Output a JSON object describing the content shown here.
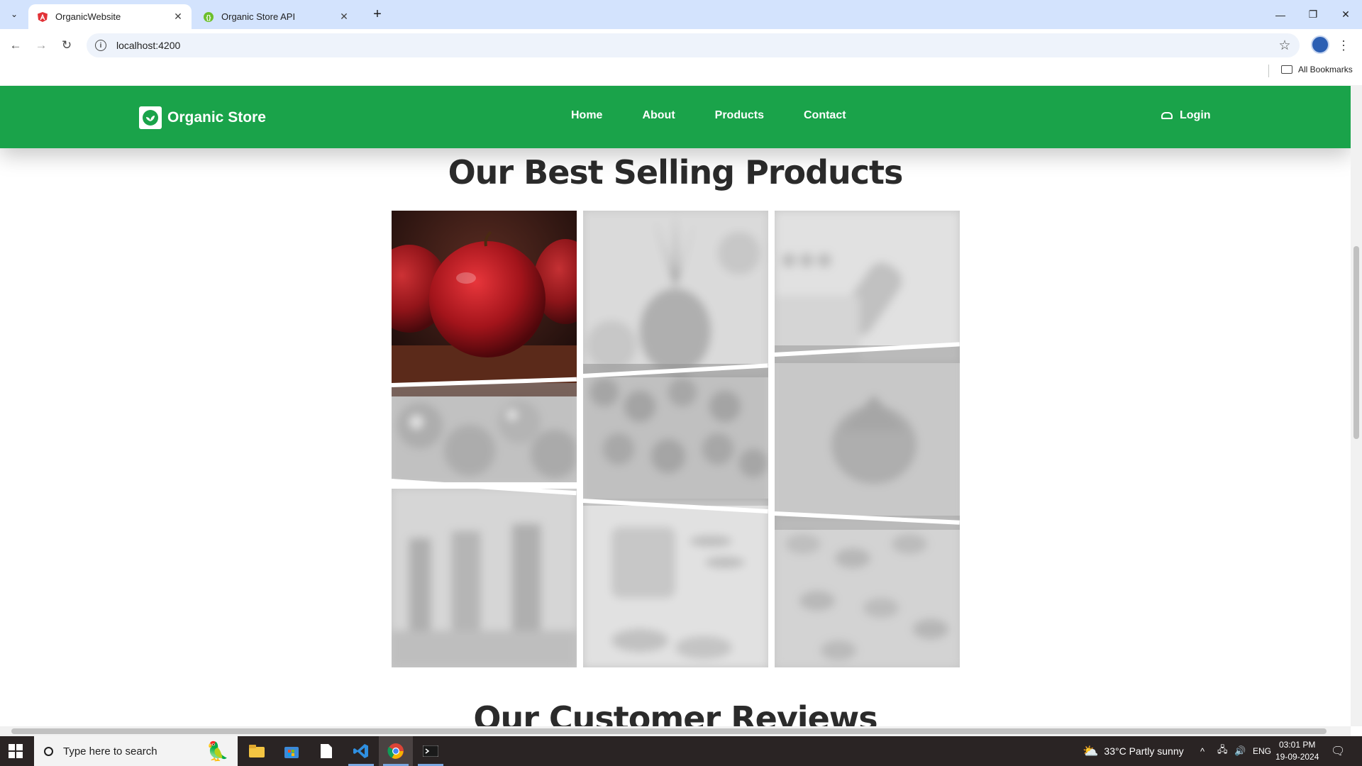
{
  "browser": {
    "tabs": [
      {
        "title": "OrganicWebsite",
        "active": true,
        "favicon": "angular-icon"
      },
      {
        "title": "Organic Store API",
        "active": false,
        "favicon": "api-icon"
      }
    ],
    "url": "localhost:4200",
    "bookmarks_label": "All Bookmarks"
  },
  "site": {
    "brand": "Organic Store",
    "nav": [
      "Home",
      "About",
      "Products",
      "Contact"
    ],
    "login": "Login",
    "best_selling_title": "Our Best Selling Products",
    "reviews_title": "Our Customer Reviews",
    "brand_color": "#1aa34a",
    "gallery": [
      {
        "name": "apple",
        "active": true
      },
      {
        "name": "pineapple",
        "active": false
      },
      {
        "name": "spice-jar",
        "active": false
      },
      {
        "name": "tomatoes",
        "active": false
      },
      {
        "name": "cherry-tomatoes",
        "active": false
      },
      {
        "name": "artichoke",
        "active": false
      },
      {
        "name": "oil-bottles",
        "active": false
      },
      {
        "name": "nuts-jar",
        "active": false
      },
      {
        "name": "almonds",
        "active": false
      }
    ]
  },
  "taskbar": {
    "search_placeholder": "Type here to search",
    "weather": "33°C  Partly sunny",
    "language": "ENG",
    "time": "03:01 PM",
    "date": "19-09-2024"
  }
}
